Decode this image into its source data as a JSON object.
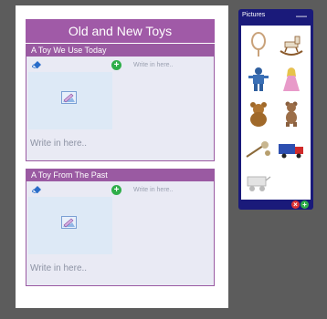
{
  "worksheet": {
    "title": "Old and New Toys",
    "cards": [
      {
        "header": "A Toy We Use Today",
        "write_small": "Write in here..",
        "write_large": "Write in here.."
      },
      {
        "header": "A Toy From The Past",
        "write_small": "Write in here..",
        "write_large": "Write in here.."
      }
    ]
  },
  "pictures_panel": {
    "title": "Pictures",
    "minimize_symbol": "—",
    "close_symbol": "×",
    "add_symbol": "+",
    "items": [
      "rattle-picture",
      "rocking-horse-picture",
      "robot-picture",
      "doll-picture",
      "teddy-bear-picture",
      "teddy-bear-old-picture",
      "spinning-top-picture",
      "toy-truck-picture",
      "toy-cart-picture"
    ]
  },
  "colors": {
    "background": "#5c5c5c",
    "accent_purple": "#a05aa7",
    "panel_blue": "#1a1a7a",
    "add_green": "#2fae49",
    "close_red": "#dd3333"
  }
}
